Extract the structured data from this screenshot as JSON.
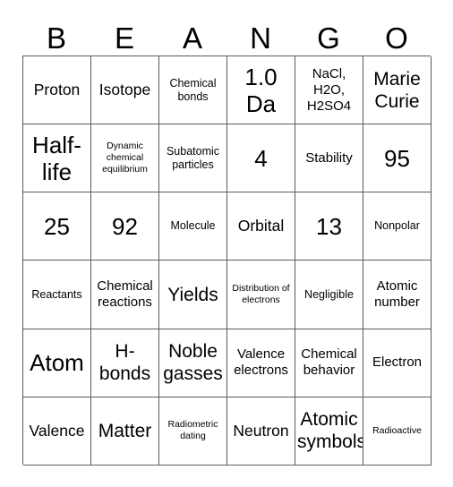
{
  "card": {
    "type": "bingo-card",
    "header_letters": [
      "B",
      "E",
      "A",
      "N",
      "G",
      "O"
    ],
    "columns": 6,
    "rows": 6,
    "border_color": "#5a5a5a",
    "background_color": "#ffffff",
    "text_color": "#000000",
    "cells": [
      [
        {
          "text": "Proton",
          "size": "lg"
        },
        {
          "text": "Isotope",
          "size": "lg"
        },
        {
          "text": "Chemical bonds",
          "size": "sm"
        },
        {
          "text": "1.0 Da",
          "size": "xxl"
        },
        {
          "text": "NaCl, H2O, H2SO4",
          "size": "md"
        },
        {
          "text": "Marie Curie",
          "size": "xl"
        }
      ],
      [
        {
          "text": "Half-life",
          "size": "xxl"
        },
        {
          "text": "Dynamic chemical equilibrium",
          "size": "xs"
        },
        {
          "text": "Subatomic particles",
          "size": "sm"
        },
        {
          "text": "4",
          "size": "xxl"
        },
        {
          "text": "Stability",
          "size": "md"
        },
        {
          "text": "95",
          "size": "xxl"
        }
      ],
      [
        {
          "text": "25",
          "size": "xxl"
        },
        {
          "text": "92",
          "size": "xxl"
        },
        {
          "text": "Molecule",
          "size": "sm"
        },
        {
          "text": "Orbital",
          "size": "lg"
        },
        {
          "text": "13",
          "size": "xxl"
        },
        {
          "text": "Nonpolar",
          "size": "sm"
        }
      ],
      [
        {
          "text": "Reactants",
          "size": "sm"
        },
        {
          "text": "Chemical reactions",
          "size": "md"
        },
        {
          "text": "Yields",
          "size": "xl"
        },
        {
          "text": "Distribution of electrons",
          "size": "xs"
        },
        {
          "text": "Negligible",
          "size": "sm"
        },
        {
          "text": "Atomic number",
          "size": "md"
        }
      ],
      [
        {
          "text": "Atom",
          "size": "xxl"
        },
        {
          "text": "H-bonds",
          "size": "xl"
        },
        {
          "text": "Noble gasses",
          "size": "xl"
        },
        {
          "text": "Valence electrons",
          "size": "md"
        },
        {
          "text": "Chemical behavior",
          "size": "md"
        },
        {
          "text": "Electron",
          "size": "md"
        }
      ],
      [
        {
          "text": "Valence",
          "size": "lg"
        },
        {
          "text": "Matter",
          "size": "xl"
        },
        {
          "text": "Radiometric dating",
          "size": "xs"
        },
        {
          "text": "Neutron",
          "size": "lg"
        },
        {
          "text": "Atomic symbols",
          "size": "xl"
        },
        {
          "text": "Radioactive",
          "size": "xs"
        }
      ]
    ]
  }
}
